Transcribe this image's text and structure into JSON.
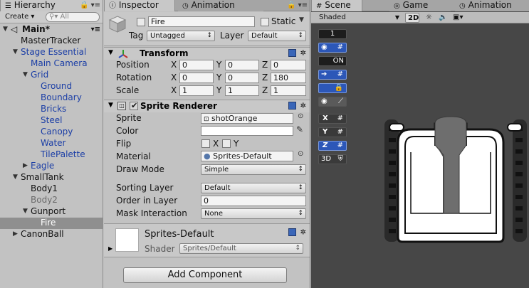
{
  "hierarchy": {
    "tab_label": "Hierarchy",
    "create_label": "Create ▾",
    "search_placeholder": "All",
    "items": [
      {
        "label": "Main*"
      },
      {
        "label": "MasterTracker"
      },
      {
        "label": "Stage Essential"
      },
      {
        "label": "Main Camera"
      },
      {
        "label": "Grid"
      },
      {
        "label": "Ground"
      },
      {
        "label": "Boundary"
      },
      {
        "label": "Bricks"
      },
      {
        "label": "Steel"
      },
      {
        "label": "Canopy"
      },
      {
        "label": "Water"
      },
      {
        "label": "TilePalette"
      },
      {
        "label": "Eagle"
      },
      {
        "label": "SmallTank"
      },
      {
        "label": "Body1"
      },
      {
        "label": "Body2"
      },
      {
        "label": "Gunport"
      },
      {
        "label": "Fire"
      },
      {
        "label": "CanonBall"
      }
    ]
  },
  "inspector": {
    "tabs": [
      {
        "label": "Inspector"
      },
      {
        "label": "Animation"
      }
    ],
    "object_name": "Fire",
    "static_label": "Static",
    "tag_label": "Tag",
    "tag_value": "Untagged",
    "layer_label": "Layer",
    "layer_value": "Default",
    "transform": {
      "title": "Transform",
      "position_label": "Position",
      "rotation_label": "Rotation",
      "scale_label": "Scale",
      "axis_x": "X",
      "axis_y": "Y",
      "axis_z": "Z",
      "position": [
        "0",
        "0",
        "0"
      ],
      "rotation": [
        "0",
        "0",
        "180"
      ],
      "scale": [
        "1",
        "1",
        "1"
      ]
    },
    "sprite_renderer": {
      "title": "Sprite Renderer",
      "sprite_label": "Sprite",
      "sprite_value": "shotOrange",
      "color_label": "Color",
      "flip_label": "Flip",
      "flip_x": "X",
      "flip_y": "Y",
      "material_label": "Material",
      "material_value": "Sprites-Default",
      "draw_mode_label": "Draw Mode",
      "draw_mode_value": "Simple",
      "sorting_layer_label": "Sorting Layer",
      "sorting_layer_value": "Default",
      "order_label": "Order in Layer",
      "order_value": "0",
      "mask_label": "Mask Interaction",
      "mask_value": "None"
    },
    "material_preview": {
      "name": "Sprites-Default",
      "shader_label": "Shader",
      "shader_value": "Sprites/Default"
    },
    "add_component_label": "Add Component"
  },
  "scene": {
    "tabs": [
      {
        "label": "Scene"
      },
      {
        "label": "Game"
      },
      {
        "label": "Animation"
      }
    ],
    "shading_mode": "Shaded",
    "mode_2d": "2D",
    "gizmos": [
      {
        "label": "1"
      },
      {
        "label": ""
      },
      {
        "label": "ON"
      },
      {
        "label": ""
      },
      {
        "label": ""
      },
      {
        "label": ""
      },
      {
        "label": "X"
      },
      {
        "label": "Y"
      },
      {
        "label": "Z"
      },
      {
        "label": "3D"
      }
    ]
  },
  "colors": {
    "panel_bg": "#c2c2c2",
    "scene_bg": "#474747",
    "selection": "#8f8f8f",
    "prefab_blue": "#1b3ea6",
    "gizmo_blue": "#2c57b8"
  }
}
